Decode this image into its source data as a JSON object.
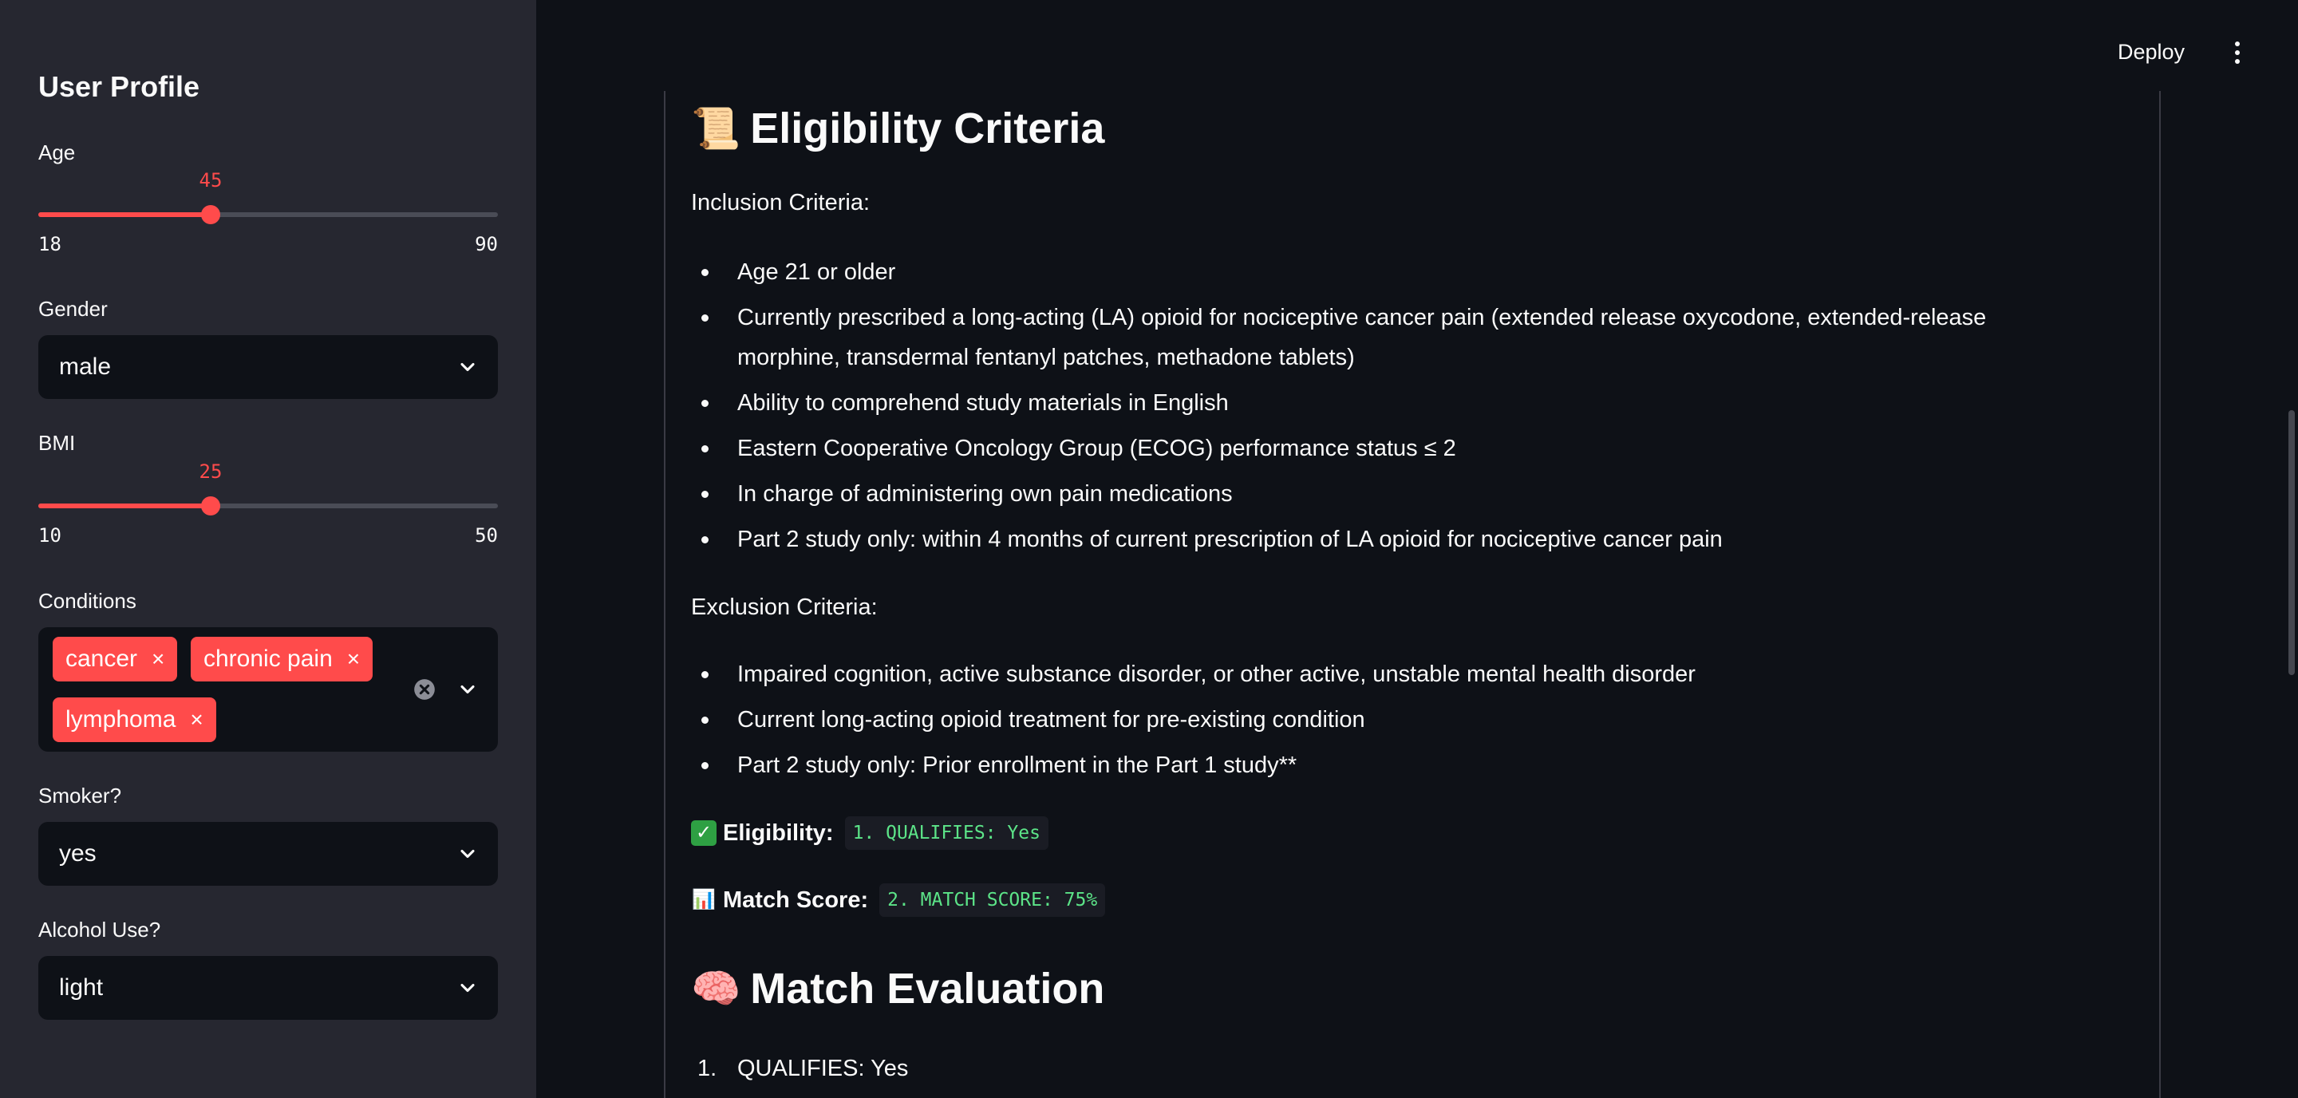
{
  "sidebar": {
    "title": "User Profile",
    "age": {
      "label": "Age",
      "value": "45",
      "min": "18",
      "max": "90",
      "fraction": 0.375
    },
    "gender": {
      "label": "Gender",
      "value": "male"
    },
    "bmi": {
      "label": "BMI",
      "value": "25",
      "min": "10",
      "max": "50",
      "fraction": 0.375
    },
    "conditions": {
      "label": "Conditions",
      "chips": [
        "cancer",
        "chronic pain",
        "lymphoma"
      ],
      "chip_remove": "×"
    },
    "smoker": {
      "label": "Smoker?",
      "value": "yes"
    },
    "alcohol": {
      "label": "Alcohol Use?",
      "value": "light"
    }
  },
  "header": {
    "deploy_label": "Deploy"
  },
  "main": {
    "eligibility_heading": "Eligibility Criteria",
    "eligibility_emoji": "📜",
    "inclusion_label": "Inclusion Criteria:",
    "inclusion": [
      "Age 21 or older",
      "Currently prescribed a long-acting (LA) opioid for nociceptive cancer pain (extended release oxycodone, extended-release morphine, transdermal fentanyl patches, methadone tablets)",
      "Ability to comprehend study materials in English",
      "Eastern Cooperative Oncology Group (ECOG) performance status ≤ 2",
      "In charge of administering own pain medications",
      "Part 2 study only: within 4 months of current prescription of LA opioid for nociceptive cancer pain"
    ],
    "exclusion_label": "Exclusion Criteria:",
    "exclusion": [
      "Impaired cognition, active substance disorder, or other active, unstable mental health disorder",
      "Current long-acting opioid treatment for pre-existing condition",
      "Part 2 study only: Prior enrollment in the Part 1 study**"
    ],
    "eligibility": {
      "emoji": "✓",
      "label": "Eligibility:",
      "value": "1. QUALIFIES: Yes"
    },
    "match_score": {
      "emoji": "📊",
      "label": "Match Score:",
      "value": "2. MATCH SCORE: 75%"
    },
    "evaluation_heading": "Match Evaluation",
    "evaluation_emoji": "🧠",
    "evaluation": [
      {
        "num": "1.",
        "text": "QUALIFIES: Yes"
      }
    ]
  },
  "colors": {
    "accent": "#ff4b4b",
    "sidebar_bg": "#262730",
    "main_bg": "#0e1117",
    "code_green": "#5ce488",
    "check_green": "#2ea043"
  }
}
